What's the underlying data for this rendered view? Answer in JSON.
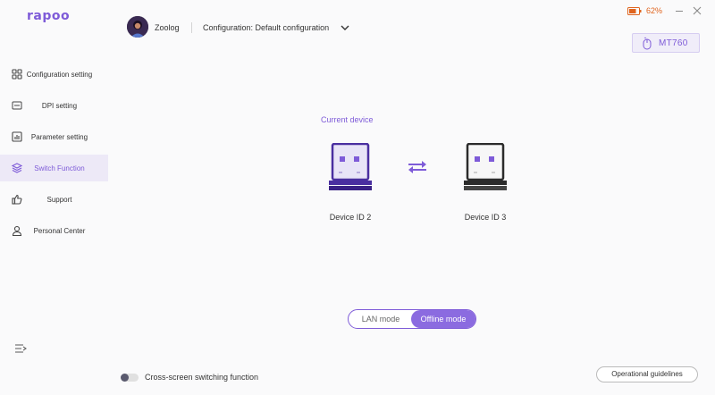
{
  "app": {
    "logo": "rapoo"
  },
  "header": {
    "username": "Zoolog",
    "configuration": "Configuration: Default configuration",
    "battery": "62%",
    "device_name": "MT760"
  },
  "sidebar": {
    "items": [
      {
        "label": "Configuration setting",
        "icon": "grid-icon",
        "active": false
      },
      {
        "label": "DPI setting",
        "icon": "dpi-icon",
        "active": false
      },
      {
        "label": "Parameter setting",
        "icon": "bar-chart-icon",
        "active": false
      },
      {
        "label": "Switch Function",
        "icon": "layers-icon",
        "active": true
      },
      {
        "label": "Support",
        "icon": "thumbs-up-icon",
        "active": false
      },
      {
        "label": "Personal Center",
        "icon": "person-icon",
        "active": false
      }
    ]
  },
  "main": {
    "current_device_label": "Current device",
    "devices": [
      {
        "label": "Device ID 2",
        "current": true
      },
      {
        "label": "Device ID 3",
        "current": false
      }
    ],
    "mode": {
      "options": [
        "LAN mode",
        "Offline mode"
      ],
      "selected": "Offline mode"
    },
    "cross_screen": {
      "label": "Cross-screen switching function",
      "enabled": false
    },
    "guide_button": "Operational guidelines"
  },
  "colors": {
    "accent": "#7e5bd8",
    "active_bg": "#ede9f7",
    "battery": "#e0641e",
    "current_dongle": "#4a2fa0",
    "other_dongle": "#2b2b2b"
  }
}
